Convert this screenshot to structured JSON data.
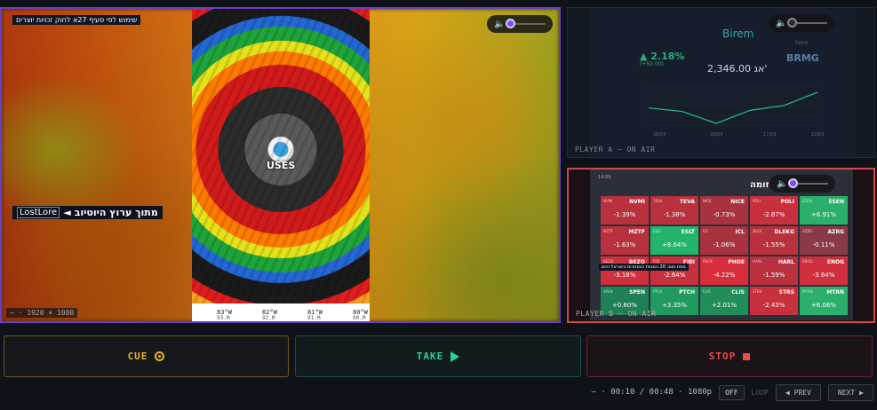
{
  "program": {
    "copyright_text": "שימוש לפי סעיף 27א לחוק זכויות יוצרים",
    "source_prefix": "מתוך ערוץ היוטיוב",
    "source_brand": "LostLore",
    "source_arrow": "◄",
    "eye_label": "USES",
    "longitudes": [
      "83°W",
      "82°W",
      "81°W",
      "80°W"
    ],
    "longitudes_sub": [
      "93.M",
      "92.M",
      "91.M",
      "90.M"
    ],
    "resolution": "— · 1920 × 1080"
  },
  "player_a": {
    "label": "PLAYER A — ON AIR",
    "stock_name": "Birem",
    "ticker_sub": "סימול",
    "ticker": "BRMG",
    "change": "▲ 2.18%",
    "change_sub": "(+50.00)",
    "price": "2,346.00 אג'",
    "chart_data": {
      "type": "line",
      "x": [
        "28/03",
        "28/03",
        "17/03",
        "22/03"
      ],
      "values": [
        2280,
        2265,
        2215,
        2270,
        2290,
        2346
      ]
    }
  },
  "player_b": {
    "label": "PLAYER B — ON AIR",
    "header": "14:09",
    "title": "זומה",
    "banner": "מפת חום: 20 המניות הנסחרות בישראל היום",
    "cells": [
      {
        "t": "NVMI",
        "t2": "NVMI",
        "p": "-1.39%",
        "c": "#b8313d"
      },
      {
        "t": "TEVA",
        "t2": "TEVA",
        "p": "-1.38%",
        "c": "#b8313d"
      },
      {
        "t": "NICE",
        "t2": "NICE",
        "p": "-0.73%",
        "c": "#a8333f"
      },
      {
        "t": "POLI",
        "t2": "POLI",
        "p": "-2.87%",
        "c": "#c9303e"
      },
      {
        "t": "ESEN",
        "t2": "ESEN",
        "p": "+6.91%",
        "c": "#2ab06a"
      },
      {
        "t": "MZTF",
        "t2": "MZTF",
        "p": "-1.63%",
        "c": "#b8313d"
      },
      {
        "t": "ESLT",
        "t2": "ESLT",
        "p": "+8.64%",
        "c": "#23b46c"
      },
      {
        "t": "ICL",
        "t2": "ICL",
        "p": "-1.06%",
        "c": "#a8333f"
      },
      {
        "t": "DLEKG",
        "t2": "DLEK",
        "p": "-1.55%",
        "c": "#b8313d"
      },
      {
        "t": "AZRG",
        "t2": "AZRG",
        "p": "-0.11%",
        "c": "#8a3a46"
      },
      {
        "t": "BEZQ",
        "t2": "BEZQ",
        "p": "-3.18%",
        "c": "#d02f3d"
      },
      {
        "t": "FIBI",
        "t2": "FIBI",
        "p": "-2.64%",
        "c": "#c9303e"
      },
      {
        "t": "PHOE",
        "t2": "PHOE",
        "p": "-4.22%",
        "c": "#d82e3c"
      },
      {
        "t": "HARL",
        "t2": "HARL",
        "p": "-1.59%",
        "c": "#b8313d"
      },
      {
        "t": "ENOG",
        "t2": "ENOG",
        "p": "-3.64%",
        "c": "#d02f3d"
      },
      {
        "t": "SPEN",
        "t2": "SPEN",
        "p": "+0.60%",
        "c": "#1f7f55"
      },
      {
        "t": "PTCH",
        "t2": "PTCH",
        "p": "+3.35%",
        "c": "#219a5f"
      },
      {
        "t": "CLIS",
        "t2": "CLIS",
        "p": "+2.01%",
        "c": "#218e59"
      },
      {
        "t": "STRS",
        "t2": "STRS",
        "p": "-2.45%",
        "c": "#c9303e"
      },
      {
        "t": "MTRN",
        "t2": "MTRN",
        "p": "+6.06%",
        "c": "#2ab06a"
      }
    ]
  },
  "controls": {
    "cue_label": "CUE",
    "take_label": "TAKE",
    "stop_label": "STOP"
  },
  "transport": {
    "timecode": "— · 00:10 / 00:48 · 1080p",
    "off_label": "OFF",
    "loop_label": "LOOP",
    "prev_label": "PREV",
    "prev_arrow": "◀",
    "next_label": "NEXT",
    "next_arrow": "▶"
  },
  "volume_icon": "speaker-icon"
}
